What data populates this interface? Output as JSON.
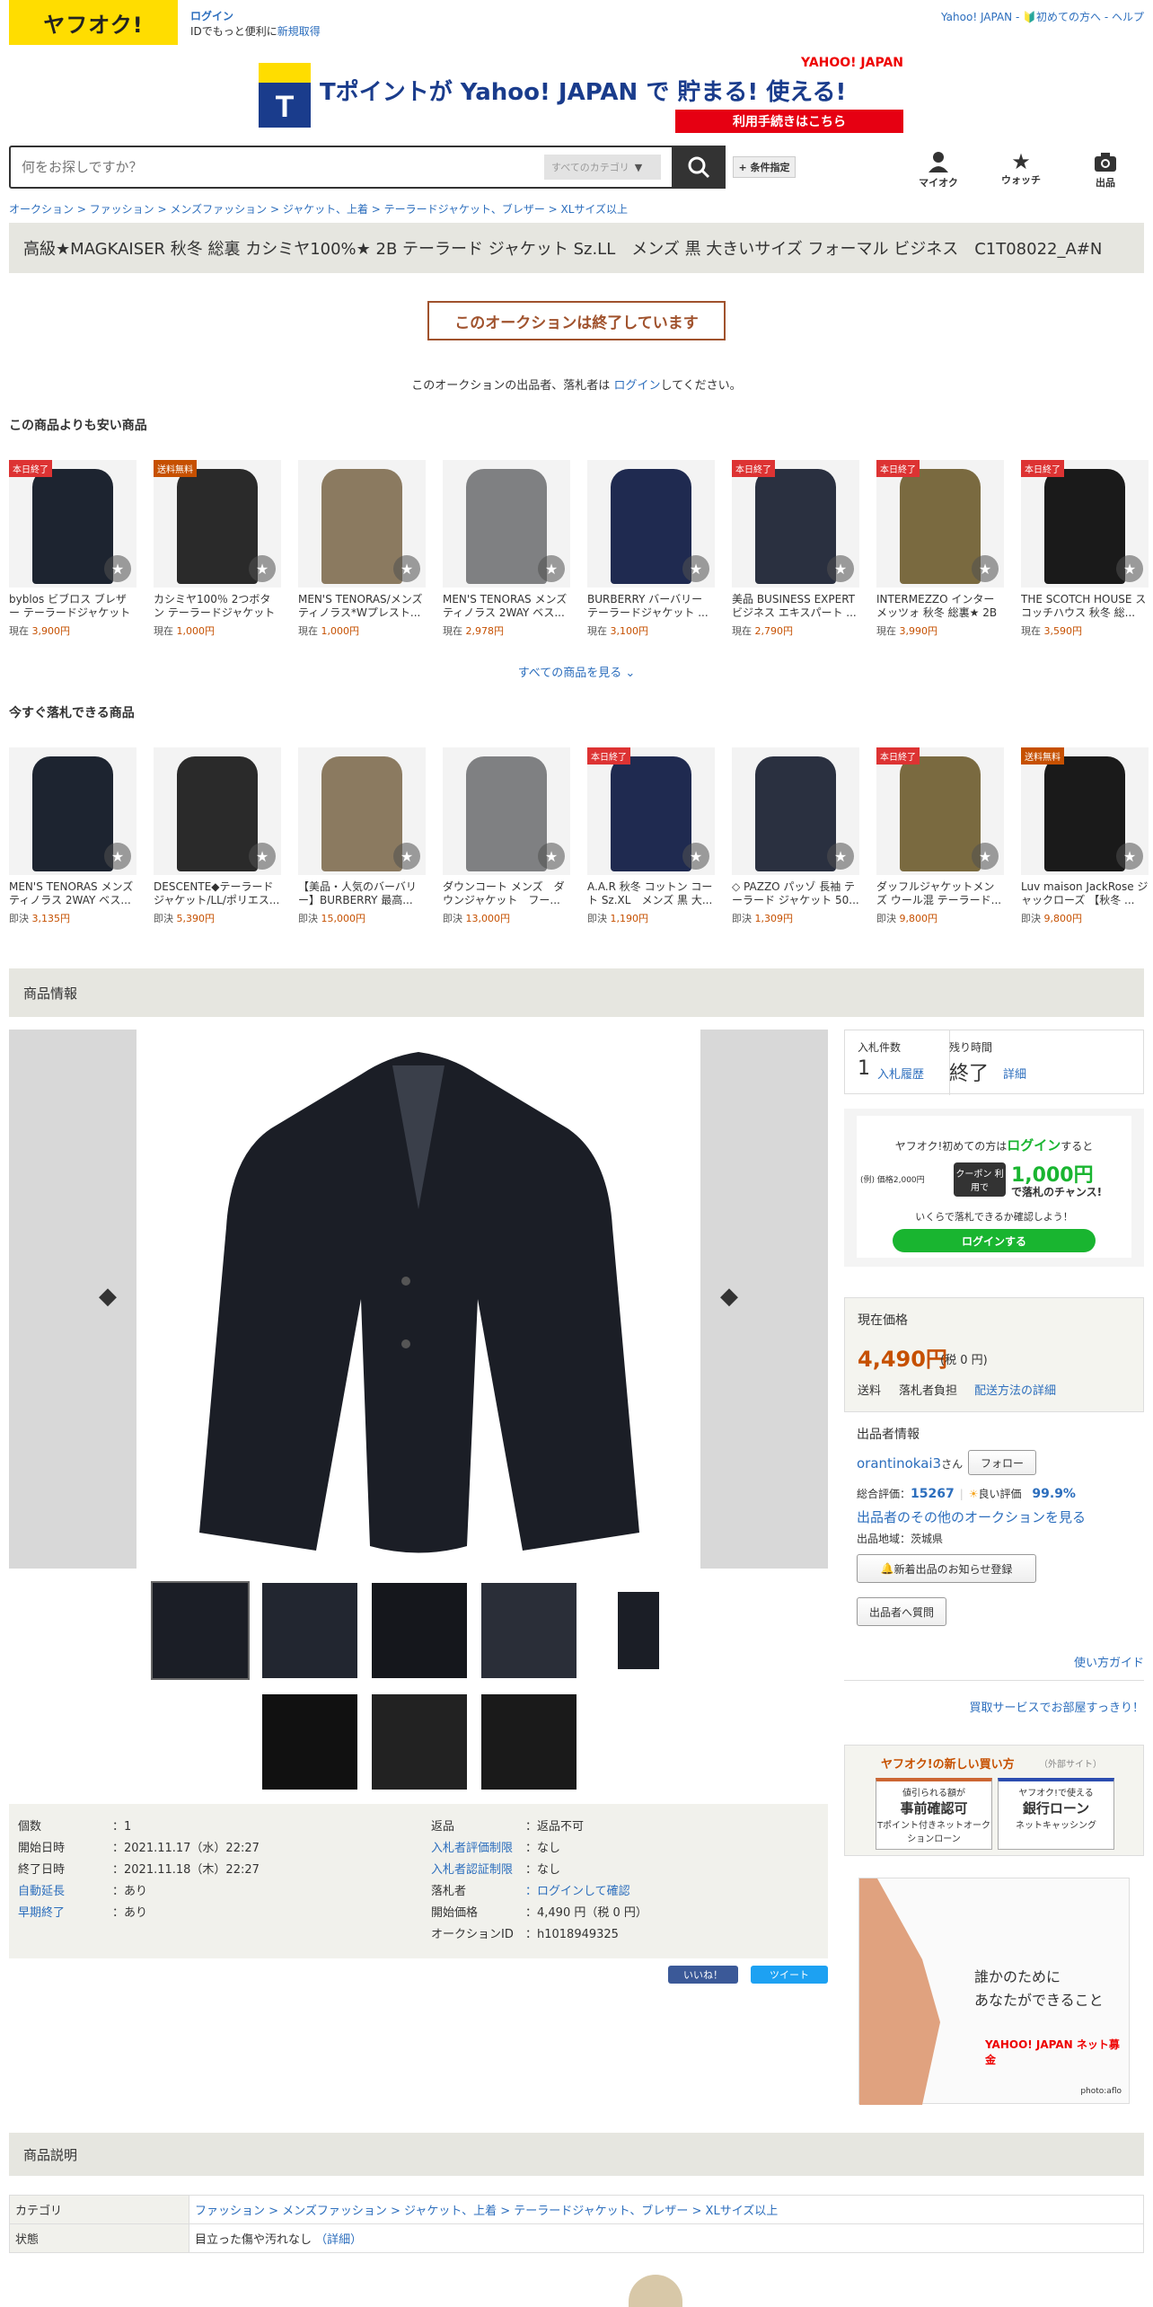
{
  "header": {
    "logo": "ヤフオク!",
    "login": "ログイン",
    "login_sub_prefix": "IDでもっと便利に",
    "signup": "新規取得",
    "right_links": "Yahoo! JAPAN - 🔰初めての方へ - ヘルプ"
  },
  "banner": {
    "brand": "Tポイントが Yahoo! JAPAN で 貯まる! 使える!",
    "yahoo": "YAHOO! JAPAN",
    "cta": "利用手続きはこちら"
  },
  "search": {
    "placeholder": "何をお探しですか？",
    "category": "すべてのカテゴリ",
    "conditions": "+ 条件指定"
  },
  "top_icons": [
    "マイオク",
    "ウォッチ",
    "出品"
  ],
  "breadcrumb": "オークション > ファッション > メンズファッション > ジャケット、上着 > テーラードジャケット、ブレザー > XLサイズ以上",
  "title": "高級★MAGKAISER 秋冬 総裏 カシミヤ100%★ 2B テーラード ジャケット Sz.LL　メンズ 黒 大きいサイズ フォーマル ビジネス　C1T08022_A#N",
  "ended_label": "このオークションは終了しています",
  "notice": {
    "pre": "このオークションの出品者、落札者は ",
    "link": "ログイン",
    "post": "してください。"
  },
  "cheaper": {
    "heading": "この商品よりも安い商品",
    "items": [
      {
        "badge": "本日終了",
        "name": "byblos ビブロス ブレザー テーラードジャケット ...",
        "price_label": "現在",
        "price": "3,900円"
      },
      {
        "badge": "送料無料",
        "name": "カシミヤ100％ 2つボタン テーラードジャケット ...",
        "price_label": "現在",
        "price": "1,000円"
      },
      {
        "badge": "",
        "name": "MEN'S TENORAS/メンズティノラス*Wプレスト...",
        "price_label": "現在",
        "price": "1,000円"
      },
      {
        "badge": "",
        "name": "MEN'S TENORAS メンズティノラス 2WAY ベス...",
        "price_label": "現在",
        "price": "2,978円"
      },
      {
        "badge": "",
        "name": "BURBERRY バーバリー テーラードジャケット ...",
        "price_label": "現在",
        "price": "3,100円"
      },
      {
        "badge": "本日終了",
        "name": "美品 BUSINESS EXPERT ビジネス エキスパート ...",
        "price_label": "現在",
        "price": "2,790円"
      },
      {
        "badge": "本日終了",
        "name": "INTERMEZZO インターメッツォ 秋冬 総裏★ 2B ...",
        "price_label": "現在",
        "price": "3,990円"
      },
      {
        "badge": "本日終了",
        "name": "THE SCOTCH HOUSE スコッチハウス 秋冬 総...",
        "price_label": "現在",
        "price": "3,590円"
      }
    ],
    "see_all": "すべての商品を見る"
  },
  "buynow": {
    "heading": "今すぐ落札できる商品",
    "items": [
      {
        "badge": "",
        "name": "MEN'S TENORAS メンズティノラス 2WAY ベス...",
        "price_label": "即決",
        "price": "3,135円"
      },
      {
        "badge": "",
        "name": "DESCENTE◆テーラードジャケット/LL/ポリエス...",
        "price_label": "即決",
        "price": "5,390円"
      },
      {
        "badge": "",
        "name": "【美品・人気のバーバリー】BURBERRY 最高...",
        "price_label": "即決",
        "price": "15,000円"
      },
      {
        "badge": "",
        "name": "ダウンコート メンズ　ダウンジャケット　フー...",
        "price_label": "即決",
        "price": "13,000円"
      },
      {
        "badge": "本日終了",
        "name": "A.A.R 秋冬 コットン コート Sz.XL　メンズ 黒 大...",
        "price_label": "即決",
        "price": "1,190円"
      },
      {
        "badge": "",
        "name": "◇ PAZZO パッゾ 長袖 テーラード ジャケット 50...",
        "price_label": "即決",
        "price": "1,309円"
      },
      {
        "badge": "本日終了",
        "name": "ダッフルジャケットメンズ ウール混 テーラード...",
        "price_label": "即決",
        "price": "9,800円"
      },
      {
        "badge": "送料無料",
        "name": "Luv maison JackRose ジャックローズ 【秋冬 ...",
        "price_label": "即決",
        "price": "9,800円"
      }
    ]
  },
  "product_info_heading": "商品情報",
  "bids": {
    "count_label": "入札件数",
    "count": "1",
    "history": "入札履歴",
    "time_label": "残り時間",
    "time": "終了",
    "detail": "詳細"
  },
  "promo": {
    "line1_pre": "ヤフオク!初めての方は",
    "line1_link": "ログイン",
    "line1_post": "すると",
    "example": "(例) 価格2,000円",
    "coupon": "クーポン 利用で",
    "amount": "1,000円",
    "chance": "で落札のチャンス!",
    "check": "いくらで落札できるか確認しよう！",
    "button": "ログインする"
  },
  "price": {
    "label": "現在価格",
    "value": "4,490円",
    "tax": "(税 0 円)",
    "ship_label": "送料",
    "ship_value": "落札者負担",
    "ship_link": "配送方法の詳細"
  },
  "seller": {
    "heading": "出品者情報",
    "name": "orantinokai3",
    "suffix": "さん",
    "follow": "フォロー",
    "rating_label": "総合評価：",
    "rating": "15267",
    "good_label": "良い評価",
    "good": "99.9%",
    "other": "出品者のその他のオークションを見る",
    "region": "出品地域：茨城県",
    "notify": "新着出品のお知らせ登録",
    "question": "出品者へ質問"
  },
  "guide": "使い方ガイド",
  "kaitori": "買取サービスでお部屋すっきり！",
  "newbuy": {
    "title": "ヤフオク!の新しい買い方",
    "ext": "（外部サイト）",
    "card1_top": "値引られる額が",
    "card1_main": "事前確認可",
    "card1_sub": "Tポイント付きネットオークションローン",
    "card2_top": "ヤフオク!で使える",
    "card2_main": "銀行ローン",
    "card2_sub": "ネットキャッシング"
  },
  "ad": {
    "line1": "誰かのために",
    "line2": "あなたができること",
    "brand": "YAHOO! JAPAN ネット募金",
    "credit": "photo:aflo"
  },
  "spec_left": [
    {
      "k": "個数",
      "v": "：1",
      "link": false
    },
    {
      "k": "開始日時",
      "v": "：2021.11.17（水）22:27",
      "link": false
    },
    {
      "k": "終了日時",
      "v": "：2021.11.18（木）22:27",
      "link": false
    },
    {
      "k": "自動延長",
      "v": "：あり",
      "link": true
    },
    {
      "k": "早期終了",
      "v": "：あり",
      "link": true
    }
  ],
  "spec_right": [
    {
      "k": "返品",
      "v": "：返品不可",
      "link": false,
      "vlink": false
    },
    {
      "k": "入札者評価制限",
      "v": "：なし",
      "link": true,
      "vlink": false
    },
    {
      "k": "入札者認証制限",
      "v": "：なし",
      "link": true,
      "vlink": false
    },
    {
      "k": "落札者",
      "v": "：ログインして確認",
      "link": false,
      "vlink": true
    },
    {
      "k": "開始価格",
      "v": "：4,490 円（税 0 円）",
      "link": false,
      "vlink": false
    },
    {
      "k": "オークションID",
      "v": "：h1018949325",
      "link": false,
      "vlink": false
    }
  ],
  "social": {
    "like": "いいね！",
    "tweet": "ツイート"
  },
  "desc_heading": "商品説明",
  "desc": {
    "cat_label": "カテゴリ",
    "cat_value": "ファッション > メンズファッション > ジャケット、上着 > テーラードジャケット、ブレザー > XLサイズ以上",
    "state_label": "状態",
    "state_value": "目立った傷や汚れなし",
    "state_link": "（詳細）"
  },
  "colors": {
    "brand_yellow": "#ffdd00",
    "accent_orange": "#c65000",
    "link": "#2c6ebd",
    "green": "#19b530"
  }
}
